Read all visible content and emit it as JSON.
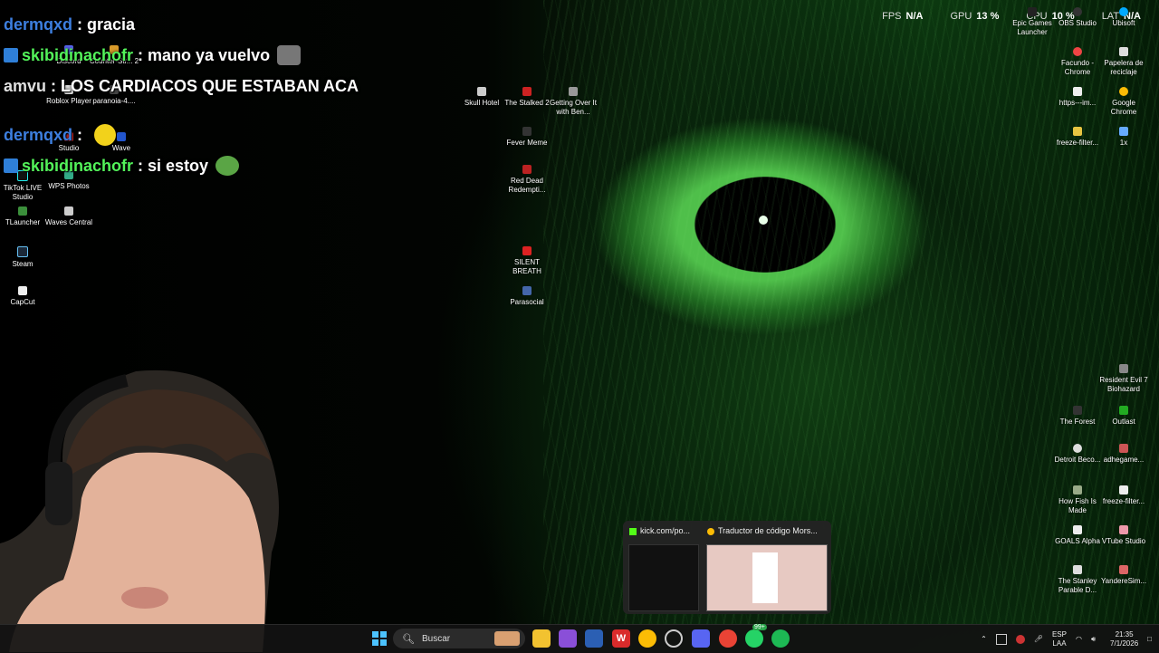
{
  "overlay_stats": [
    {
      "key": "FPS",
      "value": "N/A"
    },
    {
      "key": "GPU",
      "value": "13 %"
    },
    {
      "key": "CPU",
      "value": "10 %"
    },
    {
      "key": "LAT",
      "value": "N/A"
    }
  ],
  "chat": [
    {
      "user": "dermqxd",
      "user_color": "#3d7fe0",
      "message": "gracia",
      "badge": false,
      "emote": null
    },
    {
      "user": "skibidinachofr",
      "user_color": "#53f35a",
      "message": "mano ya vuelvo",
      "badge": true,
      "emote": "cat-emote"
    },
    {
      "user": "amvu",
      "user_color": "#e0e0e0",
      "message": "LOS CARDIACOS QUE ESTABAN ACA",
      "badge": false,
      "emote": null
    },
    {
      "user": "dermqxd",
      "user_color": "#3d7fe0",
      "message": "",
      "badge": false,
      "emote": "smiley-emote"
    },
    {
      "user": "skibidinachofr",
      "user_color": "#53f35a",
      "message": "si estoy",
      "badge": true,
      "emote": "frog-emote"
    }
  ],
  "desktop_icons_left": [
    {
      "label": "Discord"
    },
    {
      "label": "Counter-Str... 2"
    },
    {
      "label": "Roblox Player"
    },
    {
      "label": "paranoia-4...."
    },
    {
      "label": "Studio"
    },
    {
      "label": "Wave"
    },
    {
      "label": "TikTok LIVE Studio"
    },
    {
      "label": "WPS Photos"
    },
    {
      "label": "TLauncher"
    },
    {
      "label": "Waves Central"
    },
    {
      "label": "Steam"
    },
    {
      "label": "CapCut"
    }
  ],
  "desktop_icons_mid": [
    {
      "label": "Skull Hotel"
    },
    {
      "label": "The Stalked 2"
    },
    {
      "label": "Getting Over It with Ben..."
    },
    {
      "label": "Fever Meme"
    },
    {
      "label": "Red Dead Redempti..."
    },
    {
      "label": "SILENT BREATH"
    },
    {
      "label": "Parasocial"
    }
  ],
  "desktop_icons_right": [
    {
      "label": "Epic Games Launcher"
    },
    {
      "label": "OBS Studio"
    },
    {
      "label": "Ubisoft"
    },
    {
      "label": "Facundo - Chrome"
    },
    {
      "label": "Papelera de reciclaje"
    },
    {
      "label": "https---im..."
    },
    {
      "label": "Google Chrome"
    },
    {
      "label": "freeze-filter..."
    },
    {
      "label": "1x"
    },
    {
      "label": "Resident Evil 7 Biohazard"
    },
    {
      "label": "The Forest"
    },
    {
      "label": "Outlast"
    },
    {
      "label": "Detroit Beco..."
    },
    {
      "label": "adhegame..."
    },
    {
      "label": "How Fish Is Made"
    },
    {
      "label": "freeze-filter..."
    },
    {
      "label": "GOALS Alpha"
    },
    {
      "label": "VTube Studio"
    },
    {
      "label": "The Stanley Parable D..."
    },
    {
      "label": "YandereSim..."
    }
  ],
  "taskbar": {
    "search_placeholder": "Buscar",
    "whatsapp_badge": "99+",
    "lang_top": "ESP",
    "lang_bottom": "LAA",
    "time": "21:35",
    "date": "7/1/2026"
  },
  "preview": {
    "tab1_title": "kick.com/po...",
    "tab2_title": "Traductor de código Mors..."
  },
  "colors": {
    "eye_green": "#4fbf4a",
    "kick_green": "#53fc18",
    "taskbar_bg": "#121212"
  }
}
